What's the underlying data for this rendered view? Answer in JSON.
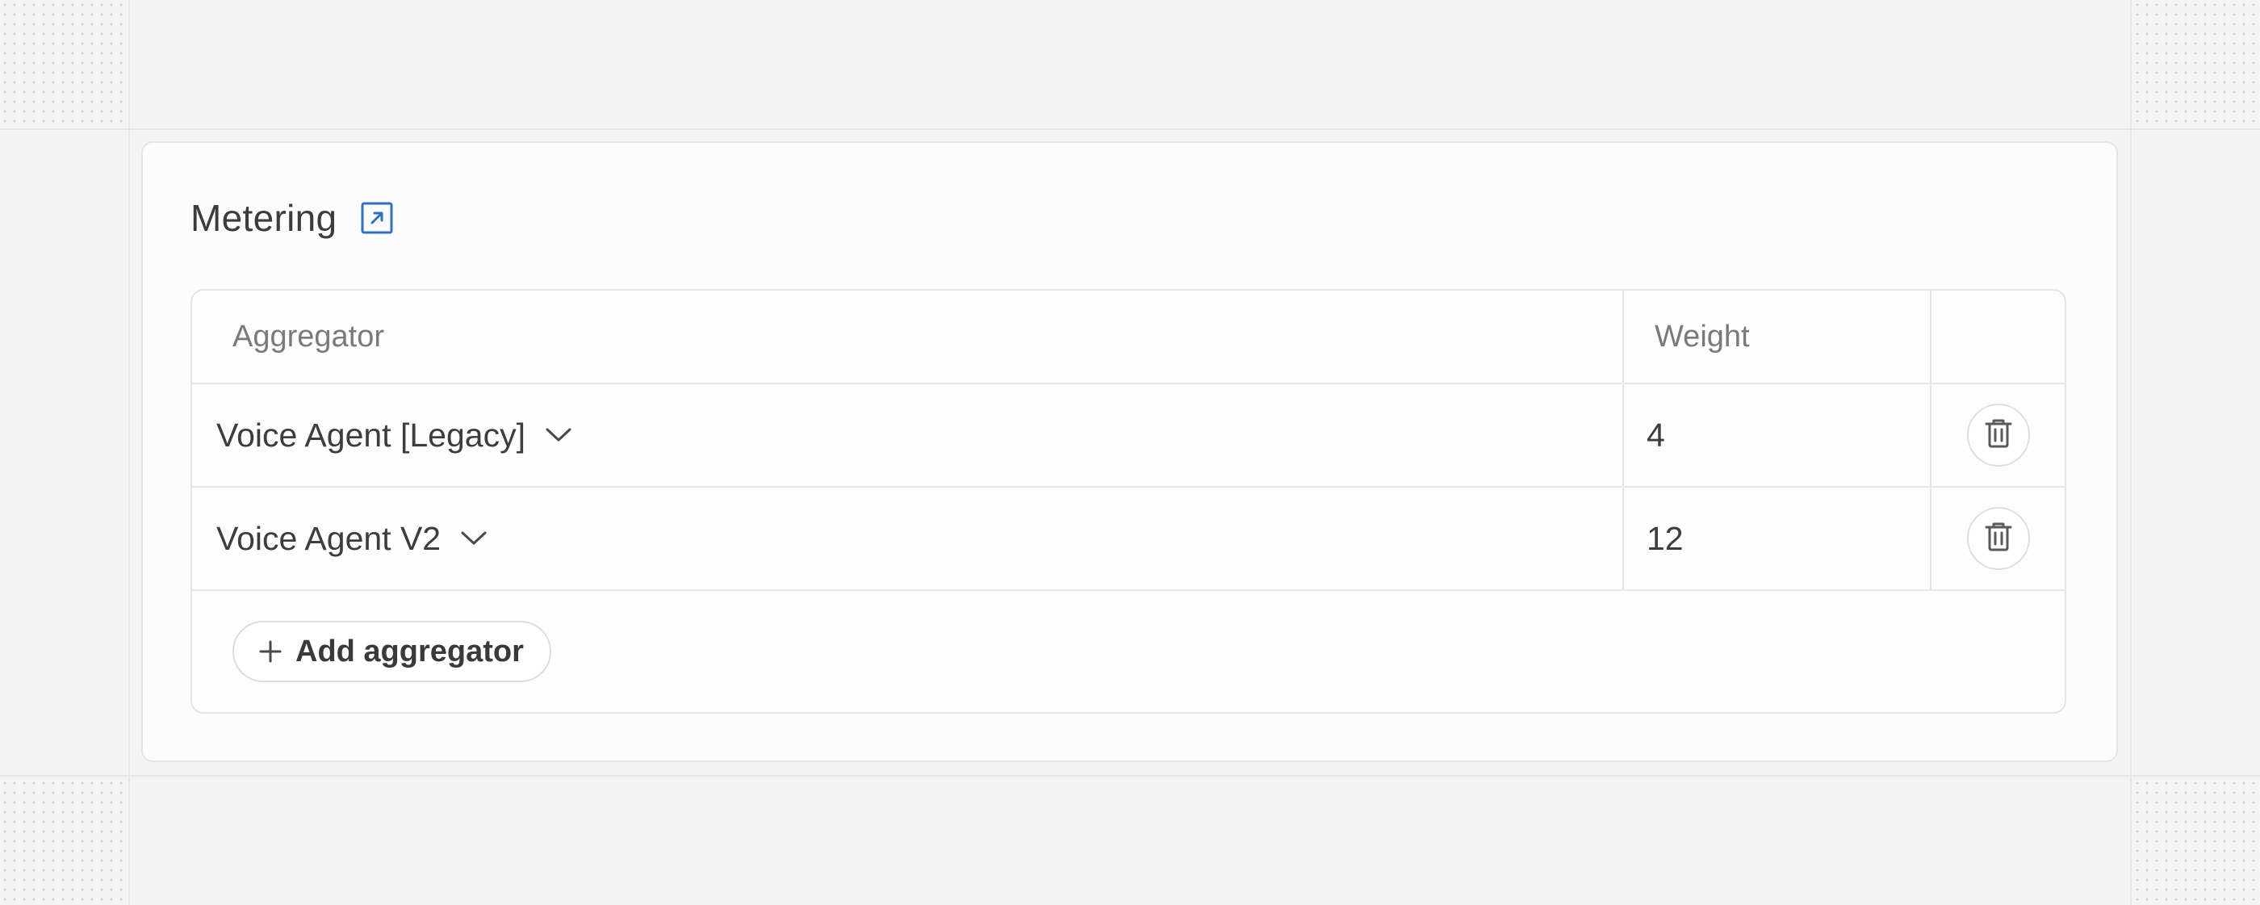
{
  "section": {
    "title": "Metering",
    "open_icon": "external-link-icon"
  },
  "table": {
    "headers": {
      "aggregator": "Aggregator",
      "weight": "Weight",
      "actions": ""
    },
    "rows": [
      {
        "aggregator": "Voice Agent [Legacy]",
        "weight": "4",
        "delete_icon": "trash-icon"
      },
      {
        "aggregator": "Voice Agent V2",
        "weight": "12",
        "delete_icon": "trash-icon"
      }
    ],
    "add_label": "Add aggregator"
  },
  "colors": {
    "accent": "#2f6fc4",
    "background": "#f4f4f4",
    "card": "#fcfcfc",
    "border": "#e4e4e4"
  }
}
